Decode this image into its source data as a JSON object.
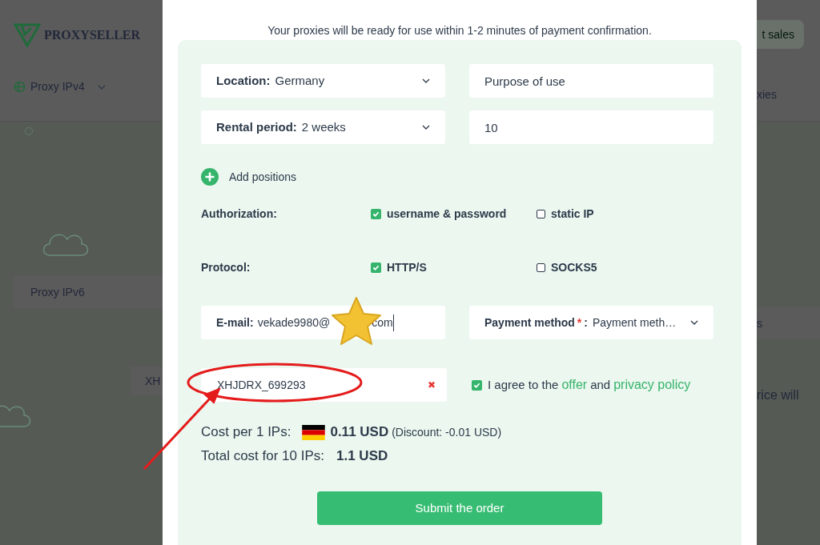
{
  "background": {
    "logo": "PROXYSELLER",
    "nav_item": "Proxy IPv4",
    "sales_button": "t sales",
    "nav_fragment": "xies",
    "ipv6_tab": "Proxy IPv6",
    "tab_fragment": "s",
    "code_fragment": "XH",
    "text_fragment": "rice will"
  },
  "modal": {
    "notice": "Your proxies will be ready for use within 1-2 minutes of payment confirmation.",
    "rows": [
      [
        {
          "kind": "select",
          "label": "Location:",
          "value": "Germany"
        },
        {
          "kind": "input",
          "placeholder": "Purpose of use"
        }
      ],
      [
        {
          "kind": "select",
          "label": "Rental period:",
          "value": "2 weeks"
        },
        {
          "kind": "input",
          "value": "10"
        }
      ]
    ],
    "add_positions": "Add positions",
    "option_groups": [
      {
        "label": "Authorization:",
        "options": [
          {
            "label": "username & password",
            "checked": true
          },
          {
            "label": "static IP",
            "checked": false
          }
        ]
      },
      {
        "label": "Protocol:",
        "options": [
          {
            "label": "HTTP/S",
            "checked": true
          },
          {
            "label": "SOCKS5",
            "checked": false
          }
        ]
      }
    ],
    "email": {
      "label": "E-mail:",
      "value_start": "vekade9980@",
      "value_end": "com"
    },
    "payment": {
      "label": "Payment method",
      "required": true,
      "required_mark": "*",
      "colon": ":",
      "value": "Payment meth…"
    },
    "coupon": {
      "value": "XHJDRX_699293",
      "clear": "✖"
    },
    "agree": {
      "checked": true,
      "text": "I agree to the",
      "link_1": "offer",
      "middle": "and",
      "link_2": "privacy policy"
    },
    "costs": [
      {
        "label": "Cost per 1 IPs:",
        "flag": true,
        "value": "0.11 USD",
        "note": "(Discount: -0.01 USD)"
      },
      {
        "label": "Total cost for 10 IPs:",
        "flag": false,
        "value": "1.1 USD"
      }
    ],
    "submit": "Submit the order"
  }
}
